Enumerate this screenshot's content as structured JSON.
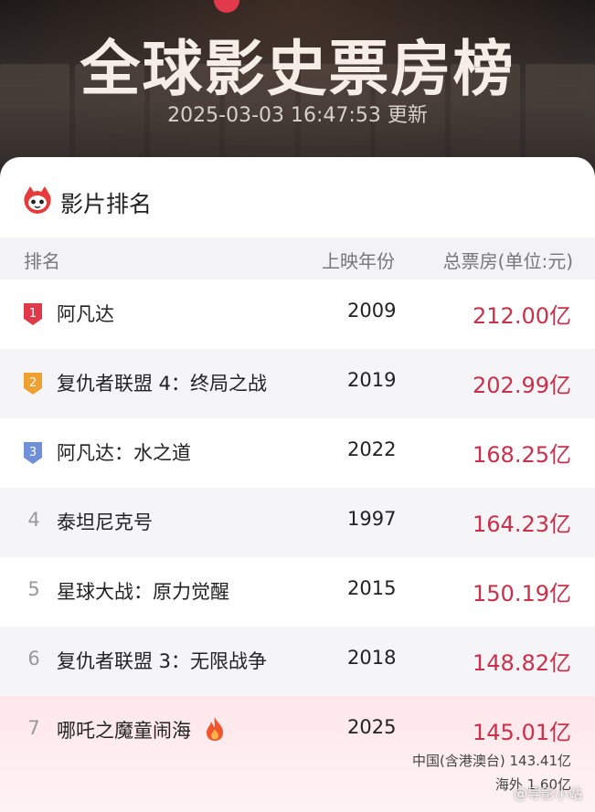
{
  "header": {
    "title": "全球影史票房榜",
    "updated": "2025-03-03 16:47:53 更新"
  },
  "card": {
    "title": "影片排名",
    "icon": "cat-logo-icon",
    "columns": [
      "排名",
      "上映年份",
      "总票房(单位:元)"
    ]
  },
  "accent_color": "#cc2f4a",
  "rankings": [
    {
      "rank": "1",
      "title": "阿凡达",
      "year": "2009",
      "gross": "212.00亿",
      "badge_color": "#e0394a"
    },
    {
      "rank": "2",
      "title": "复仇者联盟 4：终局之战",
      "year": "2019",
      "gross": "202.99亿",
      "badge_color": "#f0a032"
    },
    {
      "rank": "3",
      "title": "阿凡达：水之道",
      "year": "2022",
      "gross": "168.25亿",
      "badge_color": "#6f8fd8"
    },
    {
      "rank": "4",
      "title": "泰坦尼克号",
      "year": "1997",
      "gross": "164.23亿"
    },
    {
      "rank": "5",
      "title": "星球大战：原力觉醒",
      "year": "2015",
      "gross": "150.19亿"
    },
    {
      "rank": "6",
      "title": "复仇者联盟 3：无限战争",
      "year": "2018",
      "gross": "148.82亿"
    },
    {
      "rank": "7",
      "title": "哪吒之魔童闹海",
      "year": "2025",
      "gross": "145.01亿",
      "icon": "fire-icon",
      "detail_1": "中国(含港澳台) 143.41亿",
      "detail_2": "海外 1.60亿"
    }
  ],
  "watermark": "@导影小站"
}
